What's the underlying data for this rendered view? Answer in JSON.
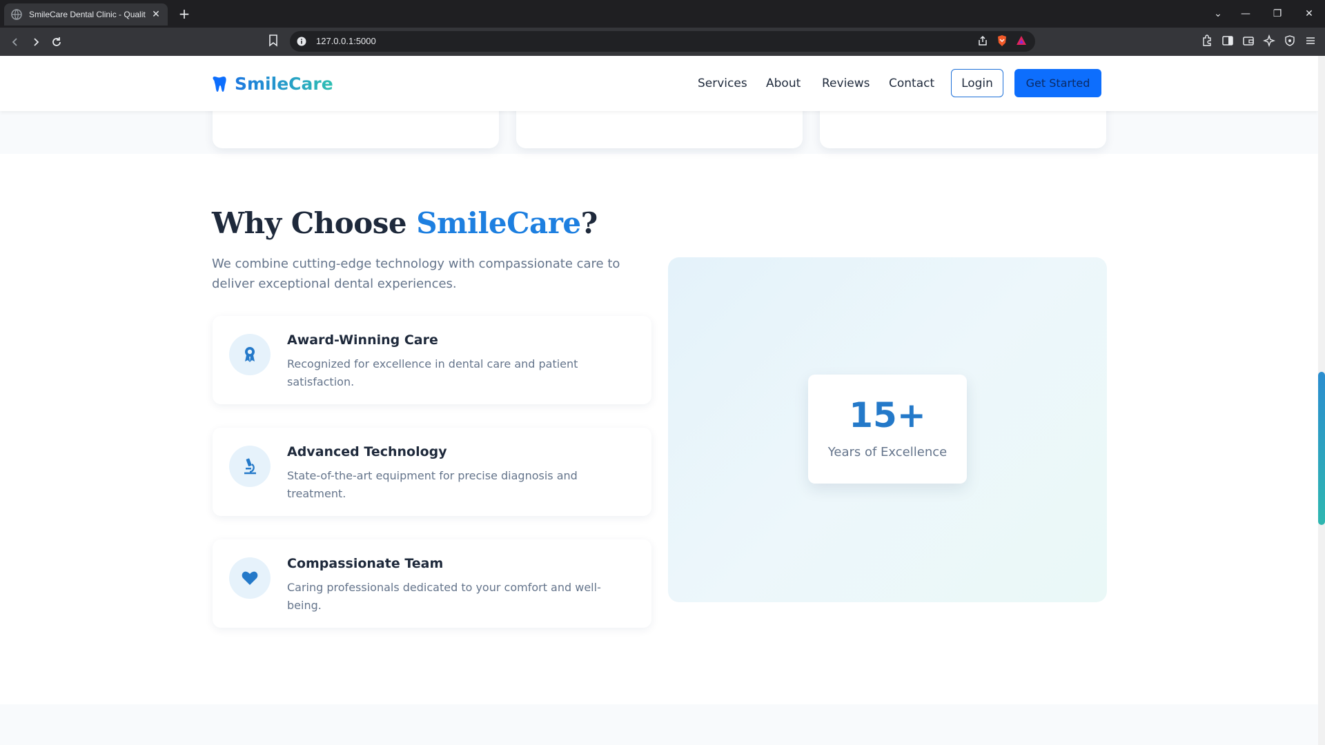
{
  "browser": {
    "tab_title": "SmileCare Dental Clinic - Quality",
    "url": "127.0.0.1:5000"
  },
  "header": {
    "brand": "SmileCare",
    "nav": [
      "Services",
      "About",
      "Reviews",
      "Contact"
    ],
    "login_label": "Login",
    "cta_label": "Get Started"
  },
  "why": {
    "title_prefix": "Why Choose ",
    "title_accent": "SmileCare",
    "title_suffix": "?",
    "subtitle": "We combine cutting-edge technology with compassionate care to deliver exceptional dental experiences.",
    "features": [
      {
        "icon": "award-icon",
        "title": "Award-Winning Care",
        "desc": "Recognized for excellence in dental care and patient satisfaction."
      },
      {
        "icon": "microscope-icon",
        "title": "Advanced Technology",
        "desc": "State-of-the-art equipment for precise diagnosis and treatment."
      },
      {
        "icon": "heart-icon",
        "title": "Compassionate Team",
        "desc": "Caring professionals dedicated to your comfort and well-being."
      }
    ],
    "stat": {
      "value": "15+",
      "label": "Years of Excellence"
    }
  },
  "colors": {
    "primary": "#0d6efd",
    "accent": "#1d7fe0",
    "teal": "#2fbfb2"
  }
}
